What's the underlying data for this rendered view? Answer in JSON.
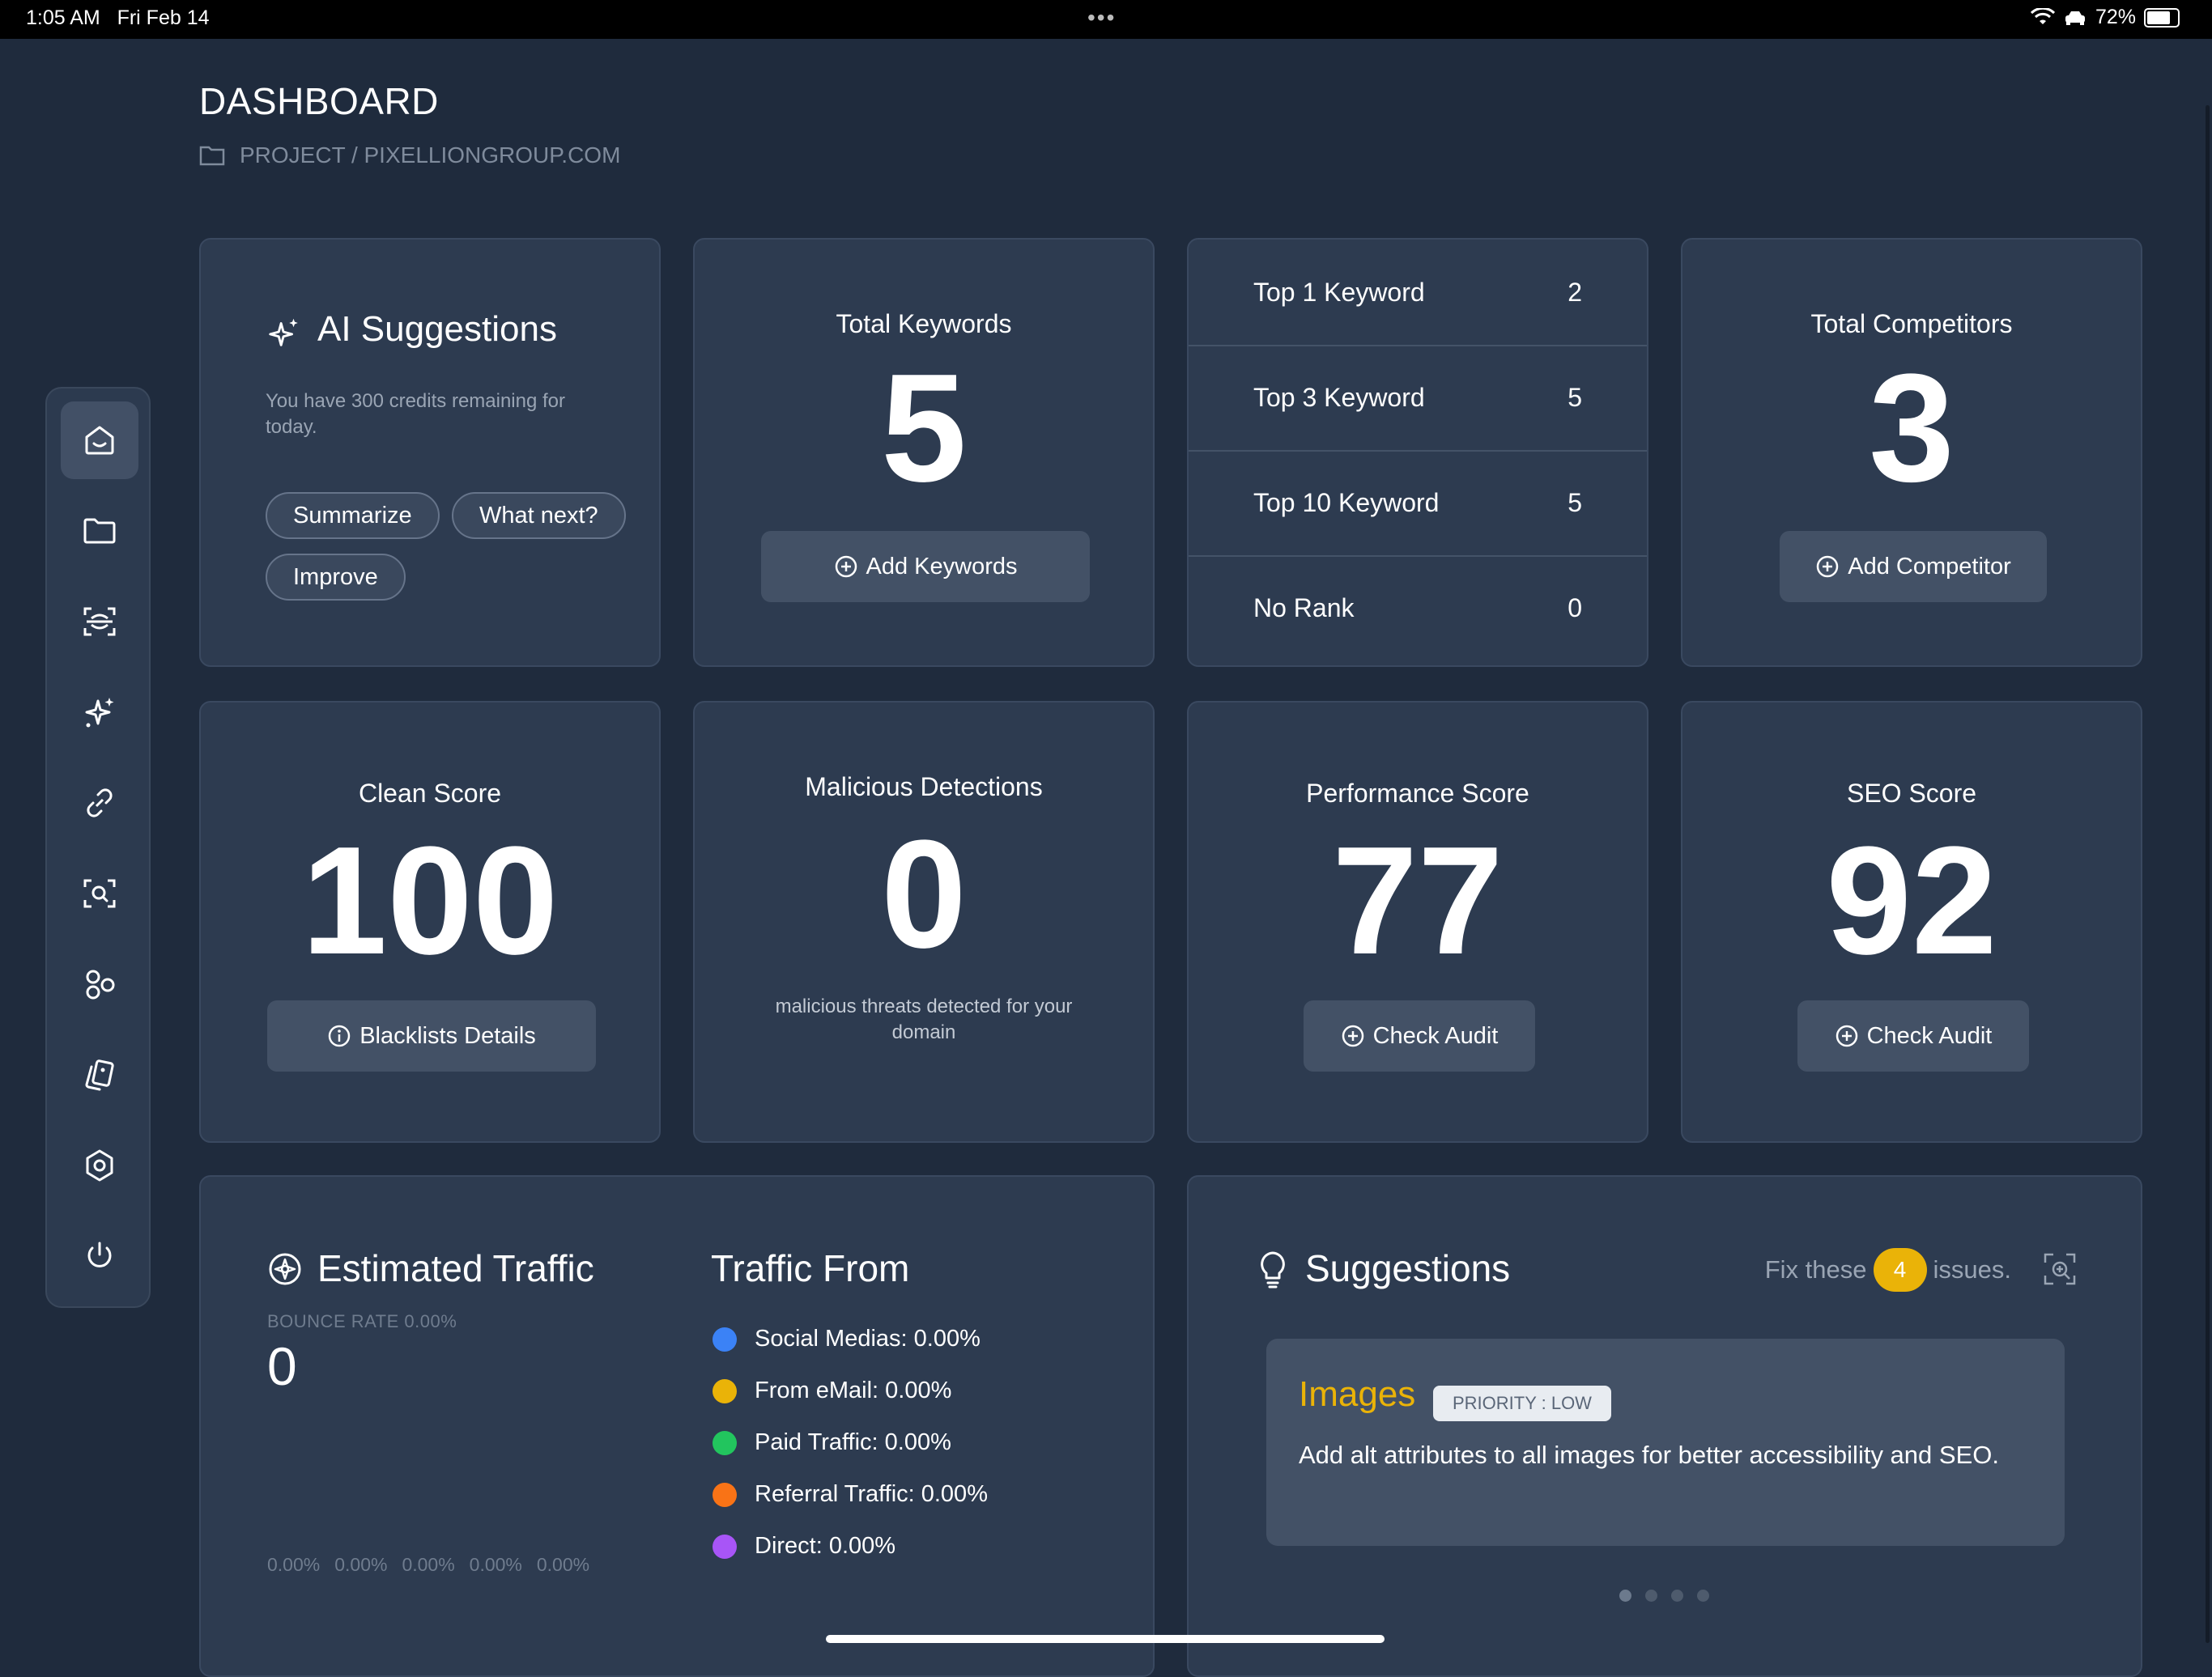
{
  "status_bar": {
    "time": "1:05 AM",
    "date": "Fri Feb 14",
    "battery": "72%"
  },
  "header": {
    "title": "DASHBOARD",
    "breadcrumb": "PROJECT / PIXELLIONGROUP.COM"
  },
  "sidebar": {
    "items": [
      {
        "icon": "home-icon",
        "active": true
      },
      {
        "icon": "folder-icon"
      },
      {
        "icon": "scan-icon"
      },
      {
        "icon": "sparkles-icon"
      },
      {
        "icon": "link-icon"
      },
      {
        "icon": "search-scan-icon"
      },
      {
        "icon": "shapes-icon"
      },
      {
        "icon": "cards-icon"
      },
      {
        "icon": "settings-icon"
      },
      {
        "icon": "power-icon"
      }
    ]
  },
  "ai_suggestions": {
    "title": "AI Suggestions",
    "subtitle": "You have 300 credits remaining for today.",
    "buttons": [
      "Summarize",
      "What next?",
      "Improve"
    ]
  },
  "total_keywords": {
    "label": "Total Keywords",
    "value": "5",
    "button": "Add Keywords"
  },
  "keyword_ranks": [
    {
      "label": "Top 1 Keyword",
      "value": "2"
    },
    {
      "label": "Top 3 Keyword",
      "value": "5"
    },
    {
      "label": "Top 10 Keyword",
      "value": "5"
    },
    {
      "label": "No Rank",
      "value": "0"
    }
  ],
  "total_competitors": {
    "label": "Total Competitors",
    "value": "3",
    "button": "Add Competitor"
  },
  "clean_score": {
    "label": "Clean Score",
    "value": "100",
    "button": "Blacklists Details"
  },
  "malicious": {
    "label": "Malicious Detections",
    "value": "0",
    "note": "malicious threats detected for your domain"
  },
  "performance": {
    "label": "Performance Score",
    "value": "77",
    "button": "Check Audit"
  },
  "seo": {
    "label": "SEO Score",
    "value": "92",
    "button": "Check Audit"
  },
  "traffic": {
    "title": "Estimated Traffic",
    "bounce": "BOUNCE RATE 0.00%",
    "value": "0",
    "axis": [
      "0.00%",
      "0.00%",
      "0.00%",
      "0.00%",
      "0.00%"
    ],
    "from_title": "Traffic From",
    "sources": [
      {
        "label": "Social Medias: 0.00%",
        "color": "#3b82f6"
      },
      {
        "label": "From eMail: 0.00%",
        "color": "#eab308"
      },
      {
        "label": "Paid Traffic: 0.00%",
        "color": "#22c55e"
      },
      {
        "label": "Referral Traffic: 0.00%",
        "color": "#f97316"
      },
      {
        "label": "Direct: 0.00%",
        "color": "#a855f7"
      }
    ]
  },
  "suggestions": {
    "title": "Suggestions",
    "fix_prefix": "Fix these",
    "count": "4",
    "fix_suffix": "issues.",
    "item": {
      "category": "Images",
      "priority": "PRIORITY : LOW",
      "text": "Add alt attributes to all images for better accessibility and SEO."
    },
    "accent": "#eab308"
  }
}
